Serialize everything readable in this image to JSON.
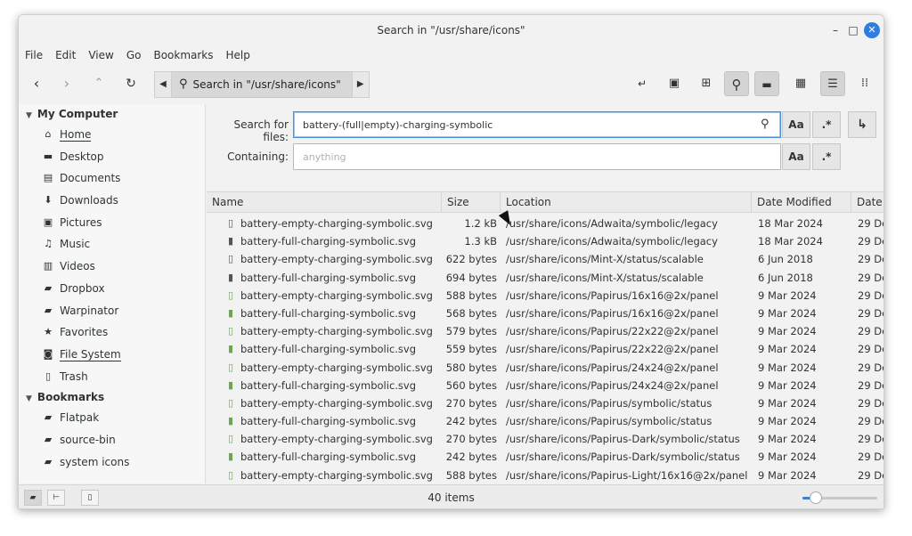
{
  "window": {
    "title": "Search in \"/usr/share/icons\""
  },
  "menu": [
    "File",
    "Edit",
    "View",
    "Go",
    "Bookmarks",
    "Help"
  ],
  "toolbar": {
    "path_label": "Search in \"/usr/share/icons\""
  },
  "search": {
    "files_label": "Search for files:",
    "files_value": "battery-(full|empty)-charging-symbolic",
    "containing_label": "Containing:",
    "containing_placeholder": "anything",
    "case_label": "Aa",
    "regex_label": ".*"
  },
  "sidebar": {
    "sections": [
      {
        "title": "My Computer",
        "items": [
          {
            "label": "Home",
            "icon": "home-icon",
            "glyph": "⌂"
          },
          {
            "label": "Desktop",
            "icon": "desktop-icon",
            "glyph": "▬"
          },
          {
            "label": "Documents",
            "icon": "documents-icon",
            "glyph": "▤"
          },
          {
            "label": "Downloads",
            "icon": "downloads-icon",
            "glyph": "⬇"
          },
          {
            "label": "Pictures",
            "icon": "pictures-icon",
            "glyph": "▣"
          },
          {
            "label": "Music",
            "icon": "music-icon",
            "glyph": "♫"
          },
          {
            "label": "Videos",
            "icon": "videos-icon",
            "glyph": "▥"
          },
          {
            "label": "Dropbox",
            "icon": "folder-icon",
            "glyph": "▰"
          },
          {
            "label": "Warpinator",
            "icon": "folder-icon",
            "glyph": "▰"
          },
          {
            "label": "Favorites",
            "icon": "star-icon",
            "glyph": "★"
          },
          {
            "label": "File System",
            "icon": "filesystem-icon",
            "glyph": "◙"
          },
          {
            "label": "Trash",
            "icon": "trash-icon",
            "glyph": "▯"
          }
        ]
      },
      {
        "title": "Bookmarks",
        "items": [
          {
            "label": "Flatpak",
            "icon": "folder-icon",
            "glyph": "▰"
          },
          {
            "label": "source-bin",
            "icon": "folder-icon",
            "glyph": "▰"
          },
          {
            "label": "system icons",
            "icon": "folder-icon",
            "glyph": "▰"
          }
        ]
      }
    ]
  },
  "table": {
    "columns": [
      "Name",
      "Size",
      "Location",
      "Date Modified",
      "Date"
    ],
    "rows": [
      {
        "name": "battery-empty-charging-symbolic.svg",
        "size": "1.2 kB",
        "location": "/usr/share/icons/Adwaita/symbolic/legacy",
        "modified": "18 Mar 2024",
        "date": "29 De"
      },
      {
        "name": "battery-full-charging-symbolic.svg",
        "size": "1.3 kB",
        "location": "/usr/share/icons/Adwaita/symbolic/legacy",
        "modified": "18 Mar 2024",
        "date": "29 De"
      },
      {
        "name": "battery-empty-charging-symbolic.svg",
        "size": "622 bytes",
        "location": "/usr/share/icons/Mint-X/status/scalable",
        "modified": "6 Jun 2018",
        "date": "29 De"
      },
      {
        "name": "battery-full-charging-symbolic.svg",
        "size": "694 bytes",
        "location": "/usr/share/icons/Mint-X/status/scalable",
        "modified": "6 Jun 2018",
        "date": "29 De"
      },
      {
        "name": "battery-empty-charging-symbolic.svg",
        "size": "588 bytes",
        "location": "/usr/share/icons/Papirus/16x16@2x/panel",
        "modified": "9 Mar 2024",
        "date": "29 De"
      },
      {
        "name": "battery-full-charging-symbolic.svg",
        "size": "568 bytes",
        "location": "/usr/share/icons/Papirus/16x16@2x/panel",
        "modified": "9 Mar 2024",
        "date": "29 De"
      },
      {
        "name": "battery-empty-charging-symbolic.svg",
        "size": "579 bytes",
        "location": "/usr/share/icons/Papirus/22x22@2x/panel",
        "modified": "9 Mar 2024",
        "date": "29 De"
      },
      {
        "name": "battery-full-charging-symbolic.svg",
        "size": "559 bytes",
        "location": "/usr/share/icons/Papirus/22x22@2x/panel",
        "modified": "9 Mar 2024",
        "date": "29 De"
      },
      {
        "name": "battery-empty-charging-symbolic.svg",
        "size": "580 bytes",
        "location": "/usr/share/icons/Papirus/24x24@2x/panel",
        "modified": "9 Mar 2024",
        "date": "29 De"
      },
      {
        "name": "battery-full-charging-symbolic.svg",
        "size": "560 bytes",
        "location": "/usr/share/icons/Papirus/24x24@2x/panel",
        "modified": "9 Mar 2024",
        "date": "29 De"
      },
      {
        "name": "battery-empty-charging-symbolic.svg",
        "size": "270 bytes",
        "location": "/usr/share/icons/Papirus/symbolic/status",
        "modified": "9 Mar 2024",
        "date": "29 De"
      },
      {
        "name": "battery-full-charging-symbolic.svg",
        "size": "242 bytes",
        "location": "/usr/share/icons/Papirus/symbolic/status",
        "modified": "9 Mar 2024",
        "date": "29 De"
      },
      {
        "name": "battery-empty-charging-symbolic.svg",
        "size": "270 bytes",
        "location": "/usr/share/icons/Papirus-Dark/symbolic/status",
        "modified": "9 Mar 2024",
        "date": "29 De"
      },
      {
        "name": "battery-full-charging-symbolic.svg",
        "size": "242 bytes",
        "location": "/usr/share/icons/Papirus-Dark/symbolic/status",
        "modified": "9 Mar 2024",
        "date": "29 De"
      },
      {
        "name": "battery-empty-charging-symbolic.svg",
        "size": "588 bytes",
        "location": "/usr/share/icons/Papirus-Light/16x16@2x/panel",
        "modified": "9 Mar 2024",
        "date": "29 De"
      }
    ]
  },
  "status": {
    "items_text": "40 items",
    "zoom_fraction": 0.18
  },
  "colors": {
    "accent": "#2f7de1",
    "focus_border": "#4a90d9"
  }
}
